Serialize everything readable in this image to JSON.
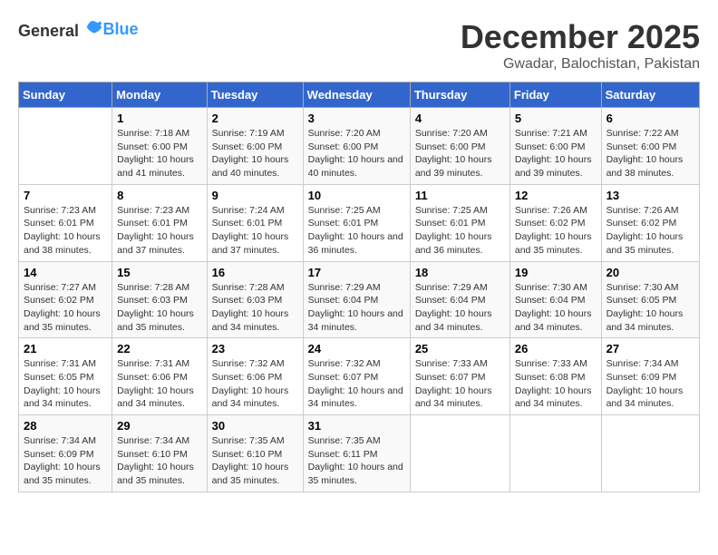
{
  "logo": {
    "text_general": "General",
    "text_blue": "Blue"
  },
  "title": "December 2025",
  "subtitle": "Gwadar, Balochistan, Pakistan",
  "days_of_week": [
    "Sunday",
    "Monday",
    "Tuesday",
    "Wednesday",
    "Thursday",
    "Friday",
    "Saturday"
  ],
  "weeks": [
    [
      {
        "day": "",
        "sunrise": "",
        "sunset": "",
        "daylight": ""
      },
      {
        "day": "1",
        "sunrise": "Sunrise: 7:18 AM",
        "sunset": "Sunset: 6:00 PM",
        "daylight": "Daylight: 10 hours and 41 minutes."
      },
      {
        "day": "2",
        "sunrise": "Sunrise: 7:19 AM",
        "sunset": "Sunset: 6:00 PM",
        "daylight": "Daylight: 10 hours and 40 minutes."
      },
      {
        "day": "3",
        "sunrise": "Sunrise: 7:20 AM",
        "sunset": "Sunset: 6:00 PM",
        "daylight": "Daylight: 10 hours and 40 minutes."
      },
      {
        "day": "4",
        "sunrise": "Sunrise: 7:20 AM",
        "sunset": "Sunset: 6:00 PM",
        "daylight": "Daylight: 10 hours and 39 minutes."
      },
      {
        "day": "5",
        "sunrise": "Sunrise: 7:21 AM",
        "sunset": "Sunset: 6:00 PM",
        "daylight": "Daylight: 10 hours and 39 minutes."
      },
      {
        "day": "6",
        "sunrise": "Sunrise: 7:22 AM",
        "sunset": "Sunset: 6:00 PM",
        "daylight": "Daylight: 10 hours and 38 minutes."
      }
    ],
    [
      {
        "day": "7",
        "sunrise": "Sunrise: 7:23 AM",
        "sunset": "Sunset: 6:01 PM",
        "daylight": "Daylight: 10 hours and 38 minutes."
      },
      {
        "day": "8",
        "sunrise": "Sunrise: 7:23 AM",
        "sunset": "Sunset: 6:01 PM",
        "daylight": "Daylight: 10 hours and 37 minutes."
      },
      {
        "day": "9",
        "sunrise": "Sunrise: 7:24 AM",
        "sunset": "Sunset: 6:01 PM",
        "daylight": "Daylight: 10 hours and 37 minutes."
      },
      {
        "day": "10",
        "sunrise": "Sunrise: 7:25 AM",
        "sunset": "Sunset: 6:01 PM",
        "daylight": "Daylight: 10 hours and 36 minutes."
      },
      {
        "day": "11",
        "sunrise": "Sunrise: 7:25 AM",
        "sunset": "Sunset: 6:01 PM",
        "daylight": "Daylight: 10 hours and 36 minutes."
      },
      {
        "day": "12",
        "sunrise": "Sunrise: 7:26 AM",
        "sunset": "Sunset: 6:02 PM",
        "daylight": "Daylight: 10 hours and 35 minutes."
      },
      {
        "day": "13",
        "sunrise": "Sunrise: 7:26 AM",
        "sunset": "Sunset: 6:02 PM",
        "daylight": "Daylight: 10 hours and 35 minutes."
      }
    ],
    [
      {
        "day": "14",
        "sunrise": "Sunrise: 7:27 AM",
        "sunset": "Sunset: 6:02 PM",
        "daylight": "Daylight: 10 hours and 35 minutes."
      },
      {
        "day": "15",
        "sunrise": "Sunrise: 7:28 AM",
        "sunset": "Sunset: 6:03 PM",
        "daylight": "Daylight: 10 hours and 35 minutes."
      },
      {
        "day": "16",
        "sunrise": "Sunrise: 7:28 AM",
        "sunset": "Sunset: 6:03 PM",
        "daylight": "Daylight: 10 hours and 34 minutes."
      },
      {
        "day": "17",
        "sunrise": "Sunrise: 7:29 AM",
        "sunset": "Sunset: 6:04 PM",
        "daylight": "Daylight: 10 hours and 34 minutes."
      },
      {
        "day": "18",
        "sunrise": "Sunrise: 7:29 AM",
        "sunset": "Sunset: 6:04 PM",
        "daylight": "Daylight: 10 hours and 34 minutes."
      },
      {
        "day": "19",
        "sunrise": "Sunrise: 7:30 AM",
        "sunset": "Sunset: 6:04 PM",
        "daylight": "Daylight: 10 hours and 34 minutes."
      },
      {
        "day": "20",
        "sunrise": "Sunrise: 7:30 AM",
        "sunset": "Sunset: 6:05 PM",
        "daylight": "Daylight: 10 hours and 34 minutes."
      }
    ],
    [
      {
        "day": "21",
        "sunrise": "Sunrise: 7:31 AM",
        "sunset": "Sunset: 6:05 PM",
        "daylight": "Daylight: 10 hours and 34 minutes."
      },
      {
        "day": "22",
        "sunrise": "Sunrise: 7:31 AM",
        "sunset": "Sunset: 6:06 PM",
        "daylight": "Daylight: 10 hours and 34 minutes."
      },
      {
        "day": "23",
        "sunrise": "Sunrise: 7:32 AM",
        "sunset": "Sunset: 6:06 PM",
        "daylight": "Daylight: 10 hours and 34 minutes."
      },
      {
        "day": "24",
        "sunrise": "Sunrise: 7:32 AM",
        "sunset": "Sunset: 6:07 PM",
        "daylight": "Daylight: 10 hours and 34 minutes."
      },
      {
        "day": "25",
        "sunrise": "Sunrise: 7:33 AM",
        "sunset": "Sunset: 6:07 PM",
        "daylight": "Daylight: 10 hours and 34 minutes."
      },
      {
        "day": "26",
        "sunrise": "Sunrise: 7:33 AM",
        "sunset": "Sunset: 6:08 PM",
        "daylight": "Daylight: 10 hours and 34 minutes."
      },
      {
        "day": "27",
        "sunrise": "Sunrise: 7:34 AM",
        "sunset": "Sunset: 6:09 PM",
        "daylight": "Daylight: 10 hours and 34 minutes."
      }
    ],
    [
      {
        "day": "28",
        "sunrise": "Sunrise: 7:34 AM",
        "sunset": "Sunset: 6:09 PM",
        "daylight": "Daylight: 10 hours and 35 minutes."
      },
      {
        "day": "29",
        "sunrise": "Sunrise: 7:34 AM",
        "sunset": "Sunset: 6:10 PM",
        "daylight": "Daylight: 10 hours and 35 minutes."
      },
      {
        "day": "30",
        "sunrise": "Sunrise: 7:35 AM",
        "sunset": "Sunset: 6:10 PM",
        "daylight": "Daylight: 10 hours and 35 minutes."
      },
      {
        "day": "31",
        "sunrise": "Sunrise: 7:35 AM",
        "sunset": "Sunset: 6:11 PM",
        "daylight": "Daylight: 10 hours and 35 minutes."
      },
      {
        "day": "",
        "sunrise": "",
        "sunset": "",
        "daylight": ""
      },
      {
        "day": "",
        "sunrise": "",
        "sunset": "",
        "daylight": ""
      },
      {
        "day": "",
        "sunrise": "",
        "sunset": "",
        "daylight": ""
      }
    ]
  ]
}
